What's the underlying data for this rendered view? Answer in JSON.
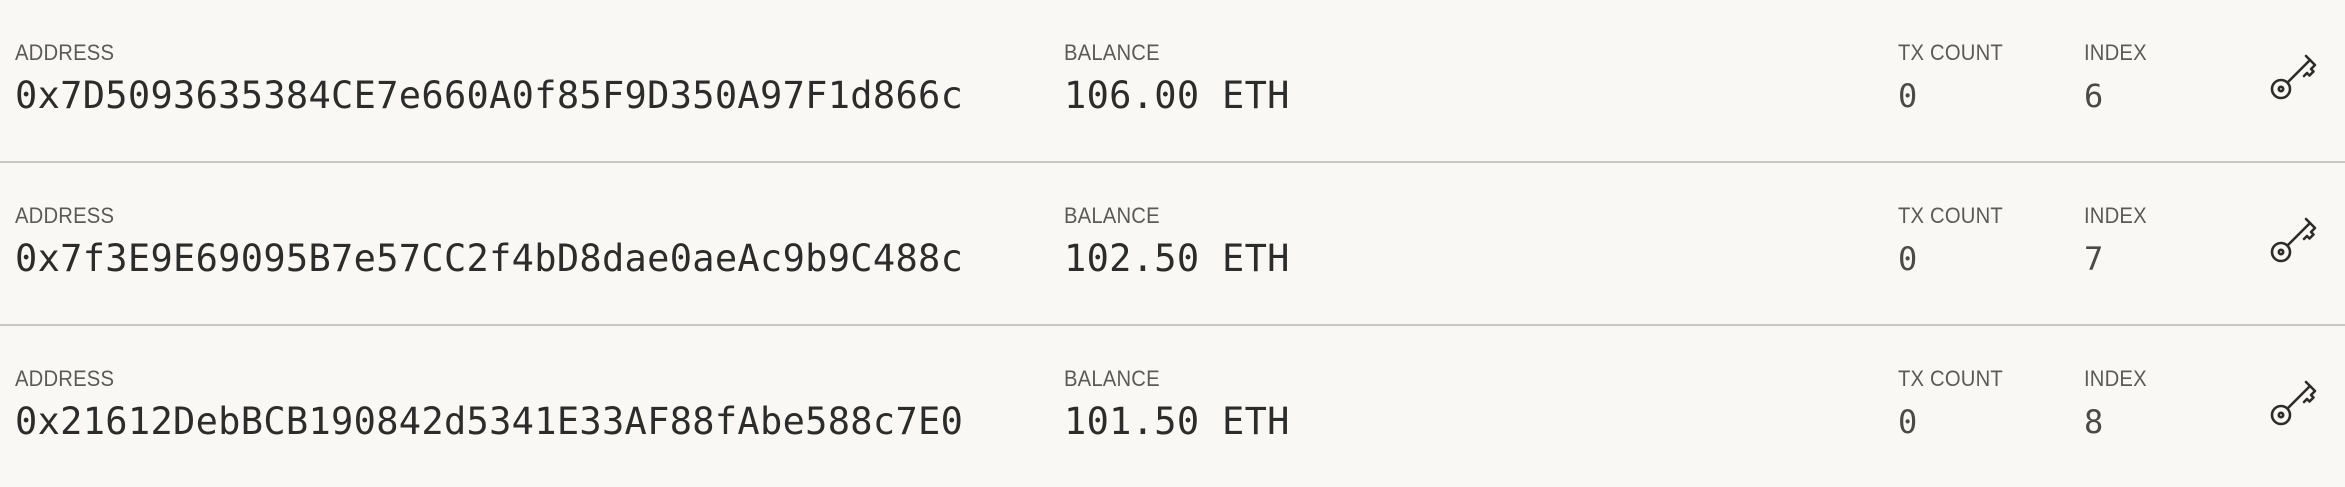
{
  "labels": {
    "address": "ADDRESS",
    "balance": "BALANCE",
    "tx_count": "TX COUNT",
    "index": "INDEX"
  },
  "accounts": [
    {
      "address": "0x7D5093635384CE7e660A0f85F9D350A97F1d866c",
      "balance": "106.00 ETH",
      "tx_count": "0",
      "index": "6"
    },
    {
      "address": "0x7f3E9E69095B7e57CC2f4bD8dae0aeAc9b9C488c",
      "balance": "102.50 ETH",
      "tx_count": "0",
      "index": "7"
    },
    {
      "address": "0x21612DebBCB190842d5341E33AF88fAbe588c7E0",
      "balance": "101.50 ETH",
      "tx_count": "0",
      "index": "8"
    }
  ],
  "icons": {
    "key": "key-icon"
  },
  "colors": {
    "background": "#f9f8f5",
    "divider": "#c9c7c2",
    "text": "#2c2c2a",
    "label": "#5a5a57"
  }
}
